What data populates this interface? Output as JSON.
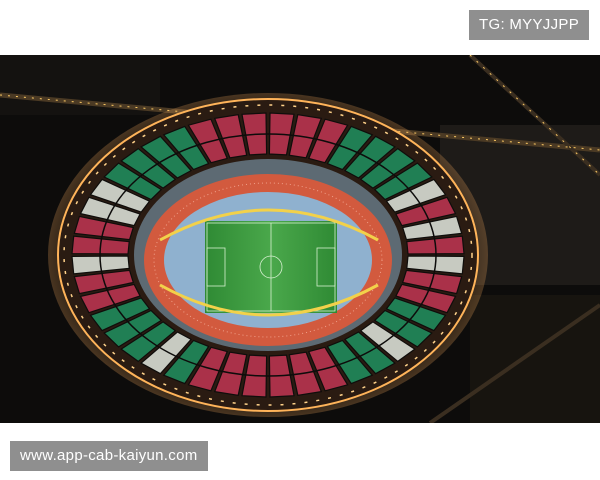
{
  "watermarks": {
    "top_right": "TG: MYYJJPP",
    "bottom_left": "www.app-cab-kaiyun.com"
  },
  "colors": {
    "page_background": "#ffffff",
    "watermark_bg": "#8f8f8f",
    "seat_green": "#1f8a5c",
    "seat_red": "#b8344f",
    "seat_white": "#d8ddd5",
    "running_track": "#d25a3e",
    "pitch": "#3c9a3f",
    "roof_lights": "#ffd28a"
  }
}
